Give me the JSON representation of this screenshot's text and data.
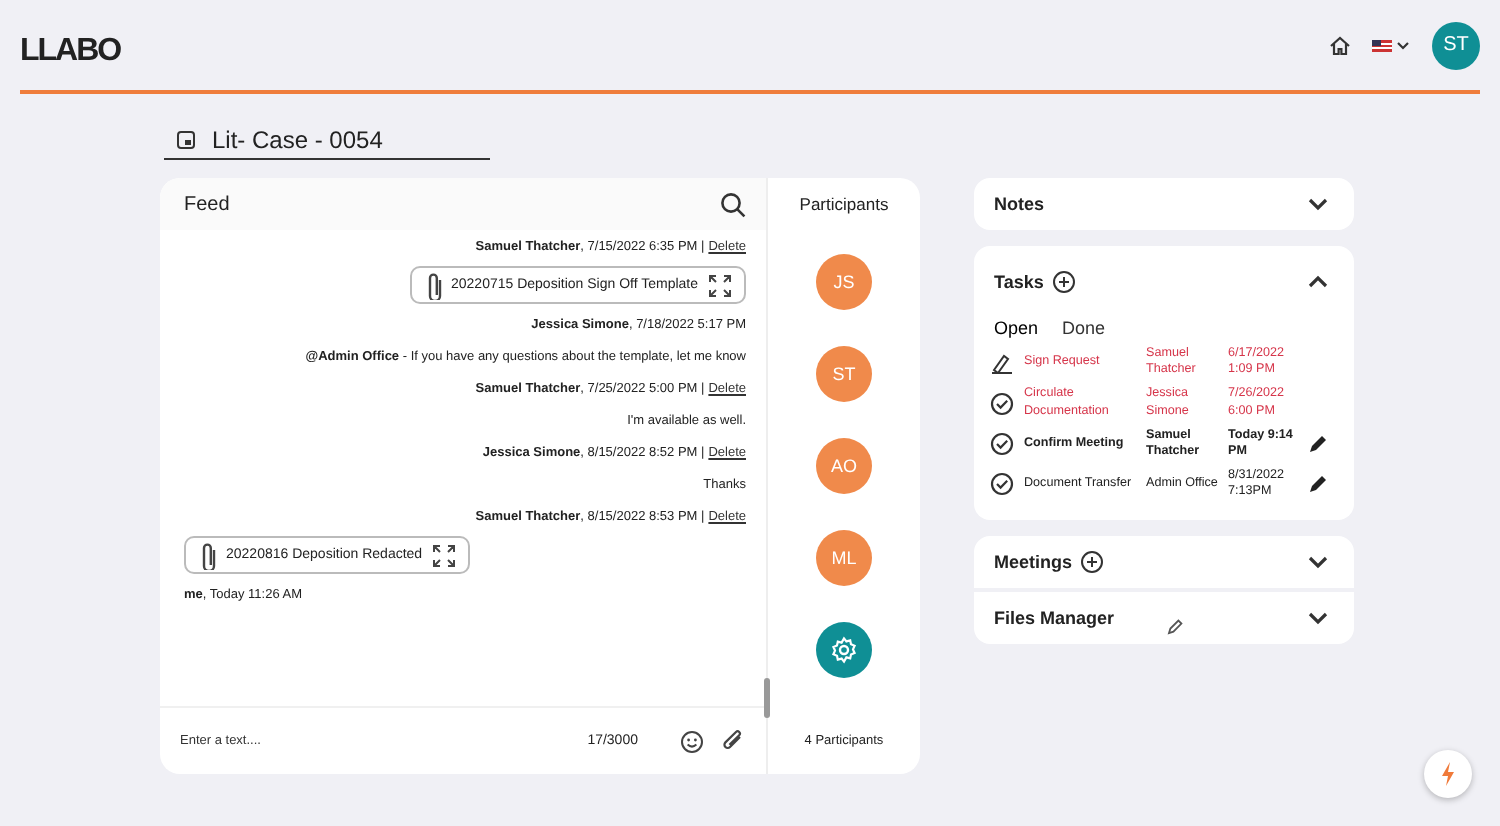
{
  "header": {
    "logo": "LLABO",
    "user_initials": "ST"
  },
  "case": {
    "title": "Lit- Case - 0054"
  },
  "feed": {
    "title": "Feed",
    "messages": [
      {
        "kind": "meta",
        "own": false,
        "author": "Samuel Thatcher",
        "time": ", 7/15/2022 6:35 PM |",
        "delete": "Delete"
      },
      {
        "kind": "attachment",
        "own": false,
        "text": "20220715 Deposition Sign Off Template"
      },
      {
        "kind": "meta",
        "own": false,
        "author": "Jessica Simone",
        "time": ", 7/18/2022 5:17 PM"
      },
      {
        "kind": "text",
        "own": false,
        "text": "**@Admin Office** - If you have any questions about the template, let me know"
      },
      {
        "kind": "meta",
        "own": false,
        "author": "Samuel Thatcher",
        "time": ", 7/25/2022 5:00 PM |",
        "delete": "Delete"
      },
      {
        "kind": "text",
        "own": false,
        "text": "I'm available as well."
      },
      {
        "kind": "meta",
        "own": false,
        "author": "Jessica Simone",
        "time": ", 8/15/2022 8:52 PM |",
        "delete": "Delete"
      },
      {
        "kind": "text",
        "own": false,
        "text": "Thanks"
      },
      {
        "kind": "meta",
        "own": false,
        "author": "Samuel Thatcher",
        "time": ", 8/15/2022 8:53 PM |",
        "delete": "Delete"
      },
      {
        "kind": "attachment",
        "own": true,
        "text": "20220816 Deposition Redacted"
      },
      {
        "kind": "meta",
        "own": true,
        "author": "me",
        "time": ", Today 11:26 AM"
      }
    ],
    "input": {
      "placeholder": "Enter a text....",
      "counter": "17/3000"
    }
  },
  "participants": {
    "title": "Participants",
    "people": [
      {
        "initials": "JS",
        "color": "#f08a4b"
      },
      {
        "initials": "ST",
        "color": "#f08a4b"
      },
      {
        "initials": "AO",
        "color": "#f08a4b"
      },
      {
        "initials": "ML",
        "color": "#f08a4b"
      }
    ],
    "count": "4 Participants"
  },
  "panels": [
    {
      "title": "Notes",
      "expanded": false,
      "add": false
    },
    {
      "title": "Tasks",
      "expanded": true,
      "add": true,
      "tabs": [
        {
          "label": "Open",
          "selected": true
        },
        {
          "label": "Done",
          "selected": false
        }
      ],
      "tasks": [
        {
          "kind": "signature",
          "overdue": true,
          "highlighted": false,
          "title": "Sign Request",
          "assignee": "Samuel Thatcher",
          "due": "6/17/2022 1:09 PM",
          "editable": false
        },
        {
          "kind": "check",
          "overdue": true,
          "highlighted": false,
          "title": "Circulate Documentation",
          "assignee": "Jessica Simone",
          "due": "7/26/2022 6:00 PM",
          "editable": false
        },
        {
          "kind": "check",
          "overdue": false,
          "highlighted": true,
          "title": "Confirm Meeting",
          "assignee": "Samuel Thatcher",
          "due": "Today 9:14 PM",
          "editable": true
        },
        {
          "kind": "check",
          "overdue": false,
          "highlighted": false,
          "title": "Document Transfer",
          "assignee": "Admin Office",
          "due": "8/31/2022 7:13PM",
          "editable": true
        }
      ]
    },
    {
      "title": "Meetings",
      "expanded": false,
      "add": true
    },
    {
      "title": "Files Manager",
      "expanded": false,
      "add": false,
      "edit": true
    }
  ]
}
